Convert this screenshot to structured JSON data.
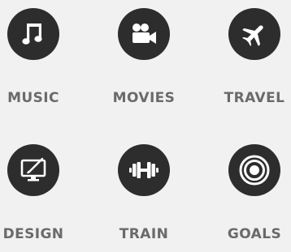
{
  "colors": {
    "background": "#f1f1f1",
    "circle": "#2d2d2d",
    "icon": "#ffffff",
    "label": "#6a6a6a"
  },
  "tiles": [
    {
      "label": "MUSIC",
      "icon": "music-note-icon"
    },
    {
      "label": "MOVIES",
      "icon": "movie-camera-icon"
    },
    {
      "label": "TRAVEL",
      "icon": "airplane-icon"
    },
    {
      "label": "DESIGN",
      "icon": "monitor-brush-icon"
    },
    {
      "label": "TRAIN",
      "icon": "dumbbell-icon"
    },
    {
      "label": "GOALS",
      "icon": "target-icon"
    }
  ]
}
